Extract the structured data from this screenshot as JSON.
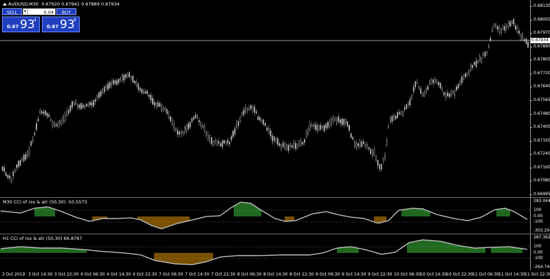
{
  "main": {
    "symbol_label": "AUDUSD,M30",
    "ohlc": "0.67920 0.67941 0.67889 0.67934",
    "current_price": "0.67934",
    "price_ticks": [
      "0.68130",
      "0.68050",
      "0.67970",
      "0.67890",
      "0.67805",
      "0.67720",
      "0.67640",
      "0.67565",
      "0.67480",
      "0.67400",
      "0.67320",
      "0.67240",
      "0.67160",
      "0.67080",
      "0.66995"
    ]
  },
  "trade_panel": {
    "sell_label": "SELL",
    "buy_label": "BUY",
    "lot_value": "0.04",
    "lot_arrow": "▾",
    "sell_quote": {
      "prefix": "0.67",
      "big": "93",
      "sup": "4"
    },
    "buy_quote": {
      "prefix": "0.67",
      "big": "93",
      "sup": "9"
    }
  },
  "indicator1": {
    "title": "M30 CCI of rsx & atr (50,30) -50.5573",
    "ticks": [
      "283.0441",
      "100",
      "0.00",
      "-100",
      "-303.2041"
    ]
  },
  "indicator2": {
    "title": "H1 CCI of rsx & atr (50,30) 66.8767",
    "ticks": [
      "287.3623",
      "100",
      "0.00",
      "-100",
      "-264.7441"
    ]
  },
  "time_axis": [
    "3 Oct 2019",
    "3 Oct 14:30",
    "3 Oct 22:30",
    "4 Oct 06:30",
    "4 Oct 14:30",
    "4 Oct 22:30",
    "7 Oct 06:30",
    "7 Oct 14:30",
    "7 Oct 22:30",
    "8 Oct 06:30",
    "8 Oct 14:30",
    "8 Oct 22:30",
    "9 Oct 06:30",
    "9 Oct 14:30",
    "9 Oct 22:30",
    "10 Oct 06:30",
    "10 Oct 14:30",
    "10 Oct 22:30",
    "11 Oct 06:30",
    "11 Oct 14:30",
    "11 Oct 22:30"
  ],
  "colors": {
    "candle": "#c8c8c8",
    "cci_line": "#c0c0c0",
    "bull_hist": "#3fd13f",
    "bear_hist": "#f0a000",
    "trade_button": "#1f3fbf"
  }
}
